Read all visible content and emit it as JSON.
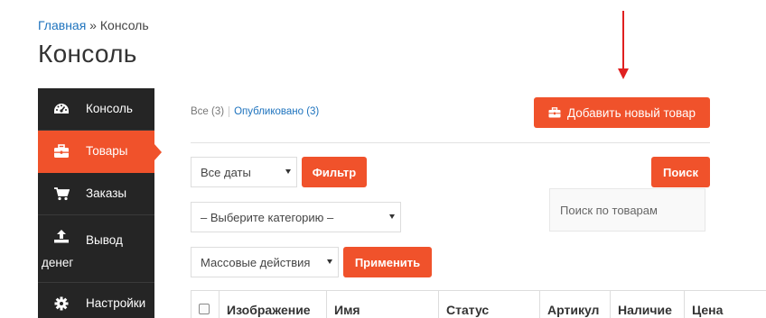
{
  "breadcrumb": {
    "home": "Главная",
    "separator": " » ",
    "current": "Консоль"
  },
  "page_title": "Консоль",
  "sidebar": {
    "items": [
      {
        "label": "Консоль",
        "icon": "dashboard-icon",
        "active": false
      },
      {
        "label": "Товары",
        "icon": "briefcase-icon",
        "active": true
      },
      {
        "label": "Заказы",
        "icon": "cart-icon",
        "active": false
      },
      {
        "label": "Вывод денег",
        "icon": "upload-icon",
        "active": false
      },
      {
        "label": "Настройки",
        "icon": "gear-icon",
        "active": false
      }
    ]
  },
  "filters": {
    "all": "Все (3)",
    "published": "Опубликовано (3)"
  },
  "add_button": {
    "label": "Добавить новый товар",
    "icon": "briefcase-icon"
  },
  "dates_select": {
    "value": "Все даты"
  },
  "filter_button": "Фильтр",
  "category_select": {
    "value": "– Выберите категорию –"
  },
  "bulk_select": {
    "value": "Массовые действия"
  },
  "apply_button": "Применить",
  "search_button": "Поиск",
  "search_input": {
    "placeholder": "Поиск по товарам"
  },
  "table": {
    "columns": [
      "Изображение",
      "Имя",
      "Статус",
      "Артикул",
      "Наличие",
      "Цена"
    ]
  },
  "colors": {
    "accent": "#f0522b",
    "sidebar_bg": "#252525",
    "link": "#1e73be",
    "annotation_arrow": "#e02020"
  }
}
